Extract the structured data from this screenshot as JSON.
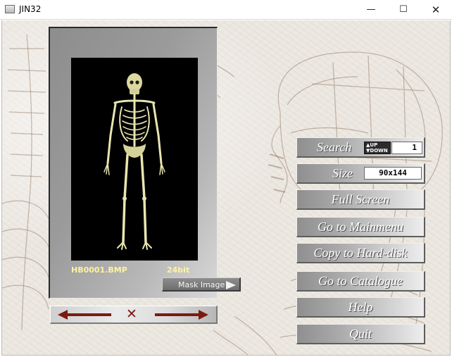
{
  "window": {
    "title": "JIN32",
    "minimize_glyph": "—",
    "maximize_glyph": "☐",
    "close_glyph": "✕"
  },
  "viewer": {
    "filename": "HB0001.BMP",
    "bit_depth": "24bit",
    "mask_button_label": "Mask Image"
  },
  "navigation": {
    "close_glyph": "✕"
  },
  "menu": {
    "search": {
      "label": "Search",
      "up": "▲UP",
      "down": "▼DOWN",
      "value": "1"
    },
    "size": {
      "label": "Size",
      "value": "90x144"
    },
    "full_screen": "Full Screen",
    "go_to_mainmenu": "Go to Mainmenu",
    "copy_to_hard_disk": "Copy to Hard-disk",
    "go_to_catalogue": "Go to Catalogue",
    "help": "Help",
    "quit": "Quit"
  },
  "colors": {
    "arrow": "#7b1a12",
    "skeleton": "#e8e6b0",
    "label_yellow": "#fff3a0"
  }
}
